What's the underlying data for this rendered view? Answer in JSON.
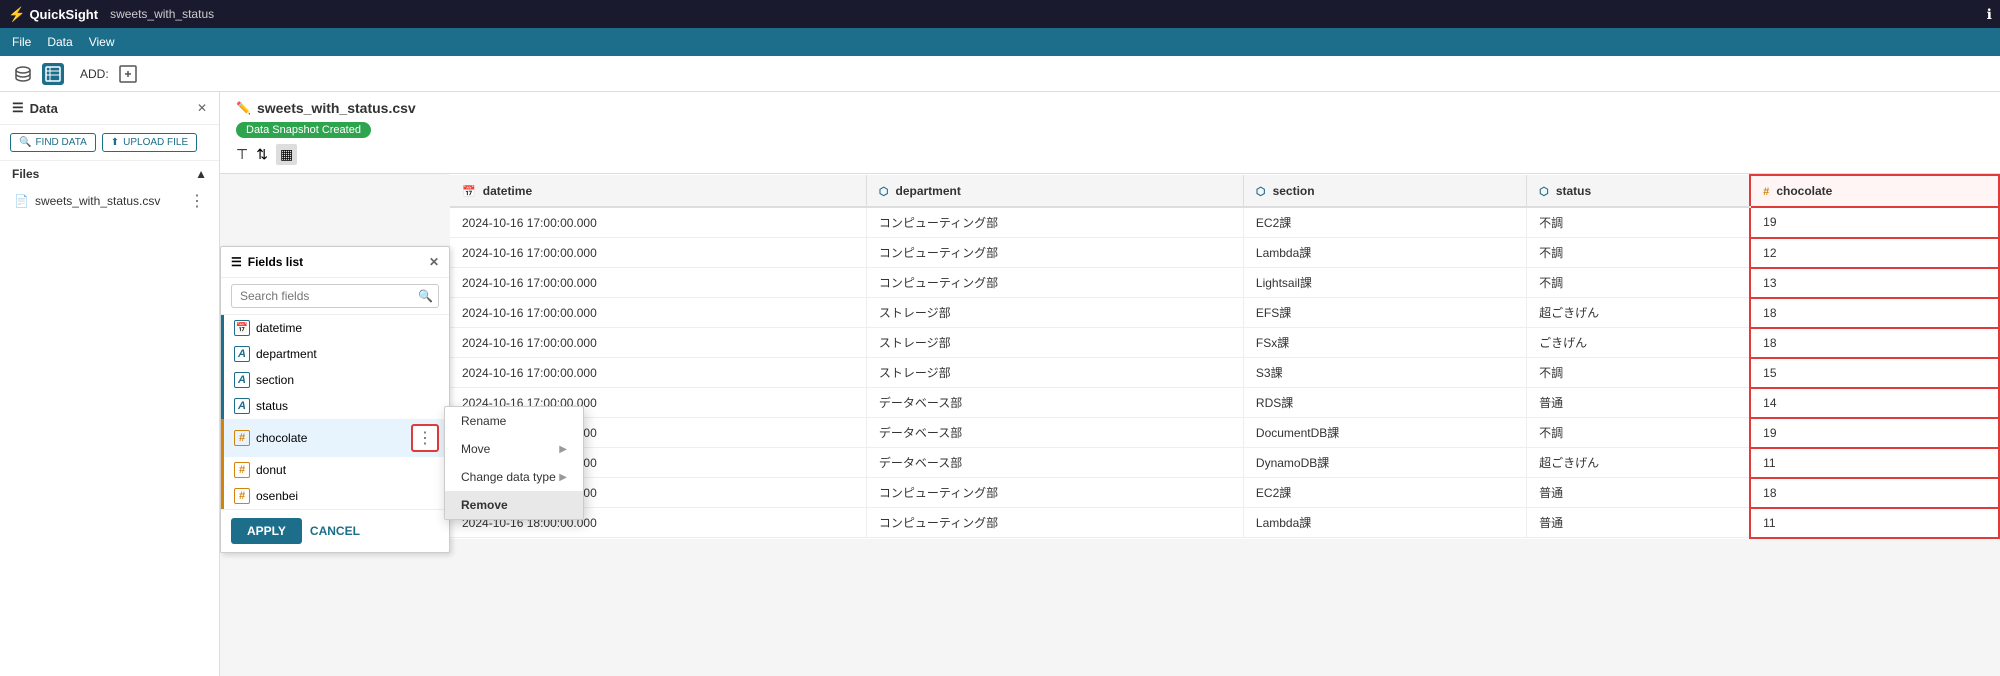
{
  "titleBar": {
    "appName": "QuickSight",
    "filename": "sweets_with_status"
  },
  "menuBar": {
    "items": [
      "File",
      "Data",
      "View"
    ]
  },
  "toolbar": {
    "addLabel": "ADD:"
  },
  "sidebar": {
    "title": "Data",
    "findDataLabel": "FIND DATA",
    "uploadFileLabel": "UPLOAD FILE",
    "filesSection": "Files",
    "files": [
      {
        "name": "sweets_with_status.csv"
      }
    ]
  },
  "contentHeader": {
    "filename": "sweets_with_status.csv",
    "snapshotBadge": "Data Snapshot Created"
  },
  "fieldsPanel": {
    "title": "Fields list",
    "searchPlaceholder": "Search fields",
    "fields": [
      {
        "name": "datetime",
        "type": "date"
      },
      {
        "name": "department",
        "type": "dim"
      },
      {
        "name": "section",
        "type": "dim"
      },
      {
        "name": "status",
        "type": "dim"
      },
      {
        "name": "chocolate",
        "type": "num",
        "selected": true
      },
      {
        "name": "donut",
        "type": "num"
      },
      {
        "name": "osenbei",
        "type": "num"
      }
    ],
    "applyLabel": "APPLY",
    "cancelLabel": "CANCEL"
  },
  "contextMenu": {
    "items": [
      {
        "label": "Rename",
        "hasSubmenu": false
      },
      {
        "label": "Move",
        "hasSubmenu": true
      },
      {
        "label": "Change data type",
        "hasSubmenu": true
      },
      {
        "label": "Remove",
        "hasSubmenu": false,
        "highlighted": true
      }
    ]
  },
  "dataTable": {
    "columns": [
      {
        "name": "datetime",
        "type": "date"
      },
      {
        "name": "department",
        "type": "dim"
      },
      {
        "name": "section",
        "type": "dim"
      },
      {
        "name": "status",
        "type": "dim"
      },
      {
        "name": "chocolate",
        "type": "num",
        "highlighted": true
      }
    ],
    "rows": [
      [
        "2024-10-16 17:00:00.000",
        "コンピューティング部",
        "EC2課",
        "不調",
        "19"
      ],
      [
        "2024-10-16 17:00:00.000",
        "コンピューティング部",
        "Lambda課",
        "不調",
        "12"
      ],
      [
        "2024-10-16 17:00:00.000",
        "コンピューティング部",
        "Lightsail課",
        "不調",
        "13"
      ],
      [
        "2024-10-16 17:00:00.000",
        "ストレージ部",
        "EFS課",
        "超ごきげん",
        "18"
      ],
      [
        "2024-10-16 17:00:00.000",
        "ストレージ部",
        "FSx課",
        "ごきげん",
        "18"
      ],
      [
        "2024-10-16 17:00:00.000",
        "ストレージ部",
        "S3課",
        "不調",
        "15"
      ],
      [
        "2024-10-16 17:00:00.000",
        "データベース部",
        "RDS課",
        "普通",
        "14"
      ],
      [
        "2024-10-16 17:00:00.000",
        "データベース部",
        "DocumentDB課",
        "不調",
        "19"
      ],
      [
        "2024-10-16 17:00:00.000",
        "データベース部",
        "DynamoDB課",
        "超ごきげん",
        "11"
      ],
      [
        "2024-10-16 18:00:00.000",
        "コンピューティング部",
        "EC2課",
        "普通",
        "18"
      ],
      [
        "2024-10-16 18:00:00.000",
        "コンピューティング部",
        "Lambda課",
        "普通",
        "11"
      ]
    ]
  }
}
